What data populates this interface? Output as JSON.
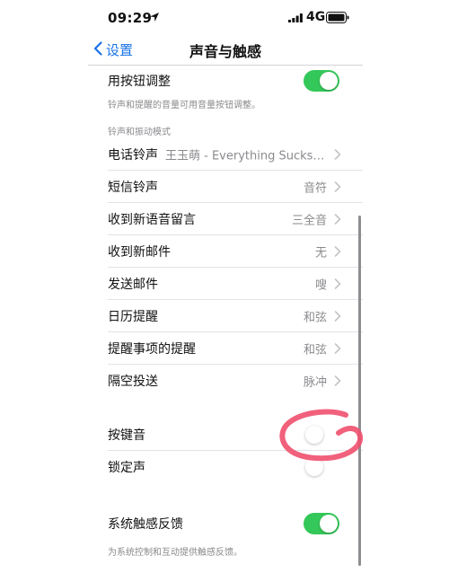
{
  "status_bar": {
    "time": "09:29",
    "network": "4G"
  },
  "nav": {
    "back_label": "设置",
    "title": "声音与触感"
  },
  "top_row": {
    "label": "用按钮调整",
    "toggle_on": true
  },
  "top_footer": "铃声和提醒的音量可用音量按钮调整。",
  "section_header": "铃声和振动模式",
  "sound_rows": [
    {
      "label": "电话铃声",
      "value": "王玉萌 - Everything Sucks (..."
    },
    {
      "label": "短信铃声",
      "value": "音符"
    },
    {
      "label": "收到新语音留言",
      "value": "三全音"
    },
    {
      "label": "收到新邮件",
      "value": "无"
    },
    {
      "label": "发送邮件",
      "value": "嗖"
    },
    {
      "label": "日历提醒",
      "value": "和弦"
    },
    {
      "label": "提醒事项的提醒",
      "value": "和弦"
    },
    {
      "label": "隔空投送",
      "value": "脉冲"
    }
  ],
  "toggles": [
    {
      "label": "按键音",
      "on": false
    },
    {
      "label": "锁定声",
      "on": false
    }
  ],
  "haptics": {
    "label": "系统触感反馈",
    "toggle_on": true
  },
  "haptics_footer": "为系统控制和互动提供触感反馈。",
  "colors": {
    "accent": "#1a73e8",
    "toggle_on": "#34c759",
    "marker": "#f0506e"
  }
}
